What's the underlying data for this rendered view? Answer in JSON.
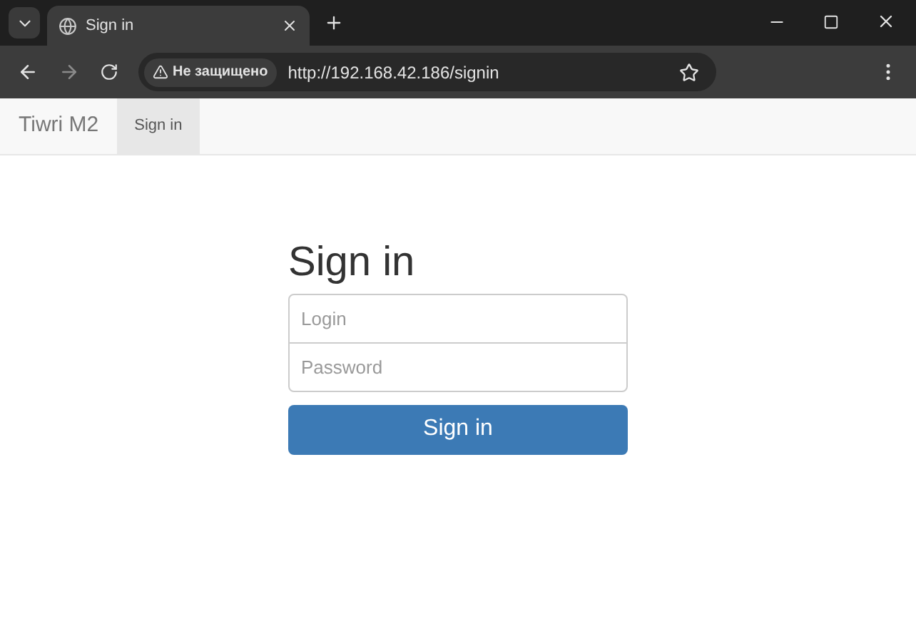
{
  "browser": {
    "tabs": [
      {
        "title": "Sign in",
        "selected": true
      }
    ],
    "security_label": "Не защищено",
    "url": "http://192.168.42.186/signin"
  },
  "navbar": {
    "brand": "Tiwri M2",
    "items": [
      {
        "label": "Sign in",
        "selected": true
      }
    ]
  },
  "form": {
    "heading": "Sign in",
    "fields": [
      {
        "placeholder": "Login"
      },
      {
        "placeholder": "Password"
      }
    ],
    "button": "Sign in"
  }
}
